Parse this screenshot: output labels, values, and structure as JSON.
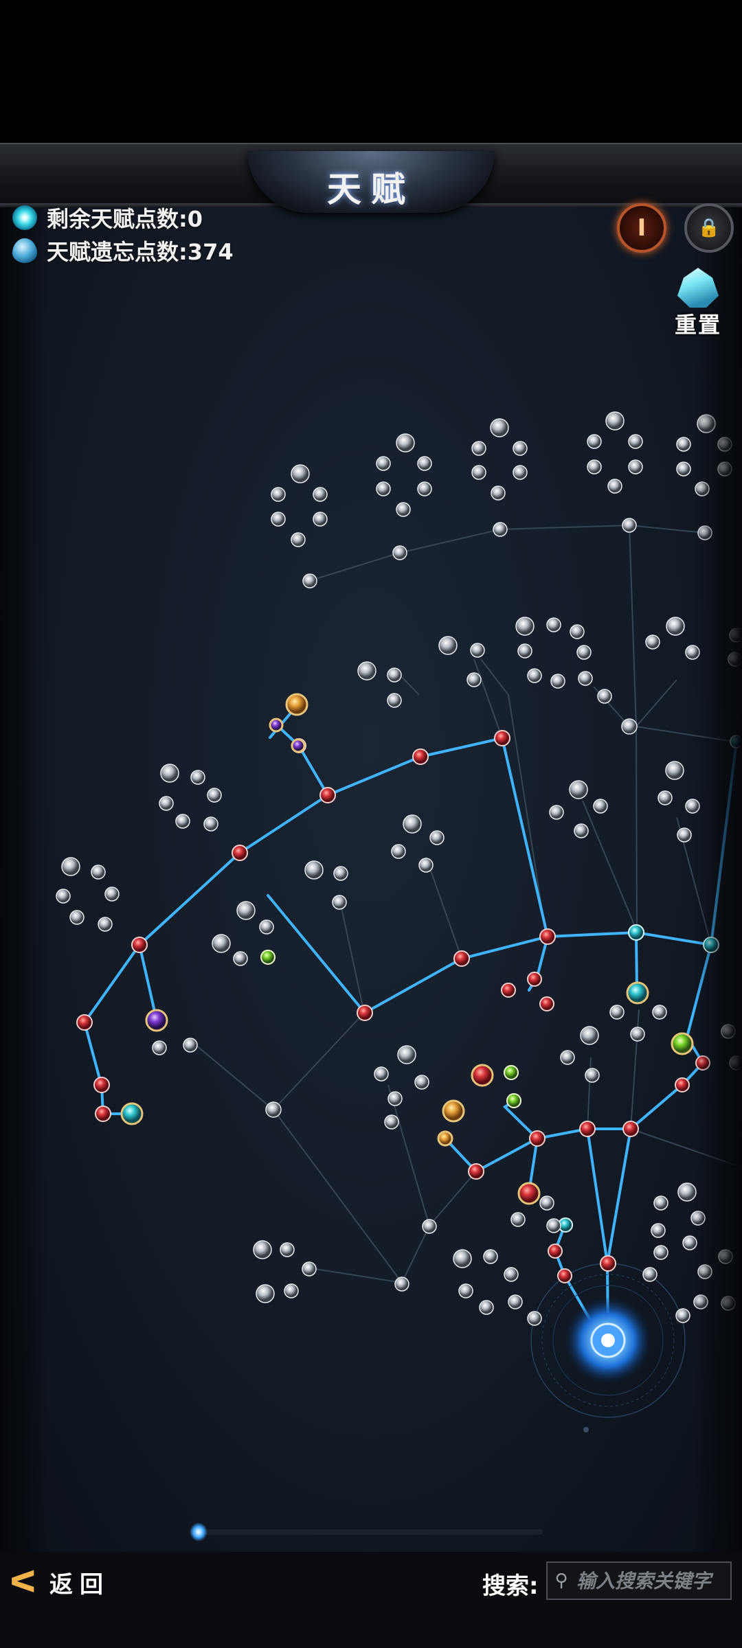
{
  "header": {
    "title": "天赋"
  },
  "stats": {
    "remaining_label": "剩余天赋点数:0",
    "forget_label": "天赋遗忘点数:374"
  },
  "buttons": {
    "info_symbol": "I",
    "lock_icon": "lock-icon",
    "reset_label": "重置"
  },
  "footer": {
    "back_label": "返回",
    "search_label": "搜索:",
    "search_placeholder": "输入搜索关键字"
  },
  "colors": {
    "active_line": "#3fb4ff",
    "inactive_line": "#3c4a58",
    "red_node": "#d8343c",
    "cyan_node": "#31c6cf",
    "green_node": "#79d22b",
    "gold_node": "#e6a13a",
    "purple_node": "#7a3bd1",
    "grey_node": "#cfd4d9"
  }
}
